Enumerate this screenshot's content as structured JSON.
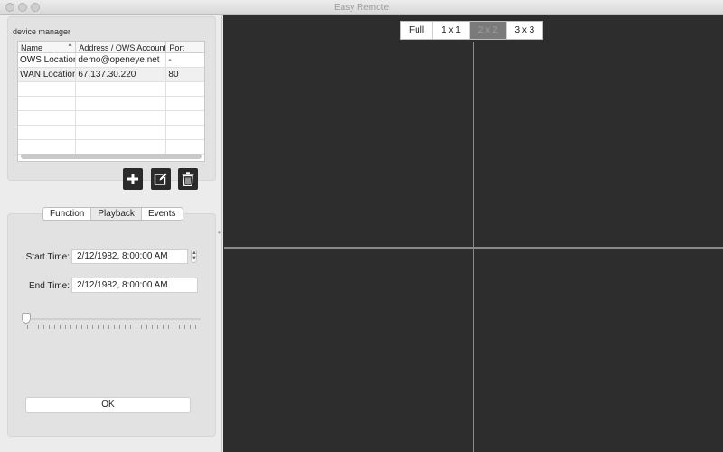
{
  "window": {
    "title": "Easy Remote"
  },
  "device_manager": {
    "label": "device manager",
    "columns": [
      "Name",
      "Address / OWS Account",
      "Port"
    ],
    "rows": [
      {
        "name": "OWS Location",
        "address": "demo@openeye.net",
        "port": "-"
      },
      {
        "name": "WAN Location",
        "address": "67.137.30.220",
        "port": "80"
      }
    ],
    "empty_rows": 5,
    "buttons": {
      "add": "add-icon",
      "edit": "edit-icon",
      "delete": "trash-icon"
    }
  },
  "tabs": [
    "Function",
    "Playback",
    "Events"
  ],
  "active_tab": "Playback",
  "playback": {
    "start_label": "Start Time:",
    "start_value": "2/12/1982,   8:00:00 AM",
    "end_label": "End Time:",
    "end_value": "2/12/1982,   8:00:00 AM",
    "slider_position": 0,
    "ok_label": "OK"
  },
  "layout_options": [
    "Full",
    "1 x 1",
    "2 x 2",
    "3 x 3"
  ],
  "layout_selected": "2 x 2",
  "colors": {
    "video_bg": "#2d2d2d",
    "grid_line": "#8a8a8a",
    "button_dark": "#2a2a2a"
  }
}
